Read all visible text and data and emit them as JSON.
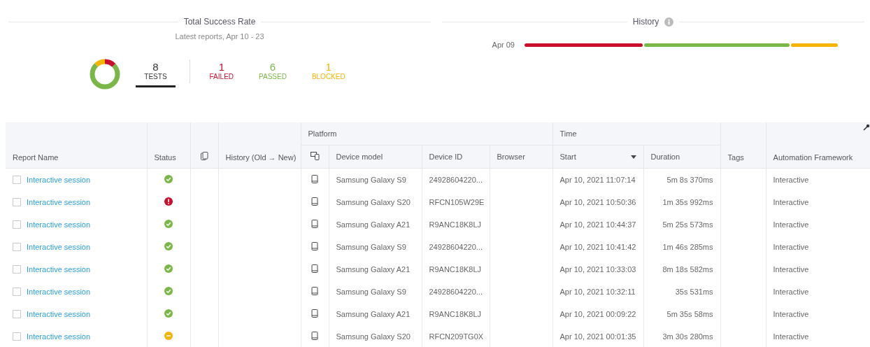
{
  "summary": {
    "title": "Total Success Rate",
    "subtitle": "Latest reports, Apr 10 - 23",
    "stats": [
      {
        "kind": "tests",
        "value": "8",
        "label": "TESTS",
        "selected": true
      },
      {
        "kind": "failed",
        "value": "1",
        "label": "FAILED",
        "color": "#c8102e",
        "selected": false
      },
      {
        "kind": "passed",
        "value": "6",
        "label": "PASSED",
        "color": "#7ab648",
        "selected": false
      },
      {
        "kind": "blocked",
        "value": "1",
        "label": "BLOCKED",
        "color": "#f5b400",
        "selected": false
      }
    ]
  },
  "history": {
    "title": "History",
    "rows": [
      {
        "date": "Apr 09",
        "segments": [
          {
            "color": "#c8102e"
          },
          {
            "color": "#7ab648"
          },
          {
            "color": "#f5b400"
          }
        ]
      }
    ]
  },
  "table": {
    "groups": [
      {
        "label": "Platform"
      },
      {
        "label": "Time"
      }
    ],
    "columns": [
      "Report Name",
      "Status",
      "History (Old → New)",
      "Device model",
      "Device ID",
      "Browser",
      "Start",
      "Duration",
      "Tags",
      "Automation Framework"
    ],
    "rows": [
      {
        "checked": false,
        "name": "Interactive session",
        "kind": "passed",
        "model": "Samsung Galaxy S9",
        "device_id": "24928604220...",
        "start": "Apr 10, 2021 11:07:14",
        "duration": "5m 8s 370ms",
        "framework": "Interactive"
      },
      {
        "checked": false,
        "name": "Interactive session",
        "kind": "failed",
        "model": "Samsung Galaxy S20",
        "device_id": "RFCN105W29E",
        "start": "Apr 10, 2021 10:50:36",
        "duration": "1m 35s 992ms",
        "framework": "Interactive"
      },
      {
        "checked": false,
        "name": "Interactive session",
        "kind": "passed",
        "model": "Samsung Galaxy A21",
        "device_id": "R9ANC18K8LJ",
        "start": "Apr 10, 2021 10:44:37",
        "duration": "5m 25s 573ms",
        "framework": "Interactive"
      },
      {
        "checked": false,
        "name": "Interactive session",
        "kind": "passed",
        "model": "Samsung Galaxy S9",
        "device_id": "24928604220...",
        "start": "Apr 10, 2021 10:41:42",
        "duration": "1m 46s 285ms",
        "framework": "Interactive"
      },
      {
        "checked": false,
        "name": "Interactive session",
        "kind": "passed",
        "model": "Samsung Galaxy A21",
        "device_id": "R9ANC18K8LJ",
        "start": "Apr 10, 2021 10:33:03",
        "duration": "8m 18s 582ms",
        "framework": "Interactive"
      },
      {
        "checked": false,
        "name": "Interactive session",
        "kind": "passed",
        "model": "Samsung Galaxy S9",
        "device_id": "24928604220...",
        "start": "Apr 10, 2021 10:32:11",
        "duration": "35s 531ms",
        "framework": "Interactive"
      },
      {
        "checked": false,
        "name": "Interactive session",
        "kind": "passed",
        "model": "Samsung Galaxy A21",
        "device_id": "R9ANC18K8LJ",
        "start": "Apr 10, 2021 00:09:22",
        "duration": "5m 35s 58ms",
        "framework": "Interactive"
      },
      {
        "checked": false,
        "name": "Interactive session",
        "kind": "blocked",
        "model": "Samsung Galaxy S20",
        "device_id": "RFCN209TG0X",
        "start": "Apr 10, 2021 00:01:35",
        "duration": "3m 30s 280ms",
        "framework": "Interactive"
      }
    ]
  }
}
